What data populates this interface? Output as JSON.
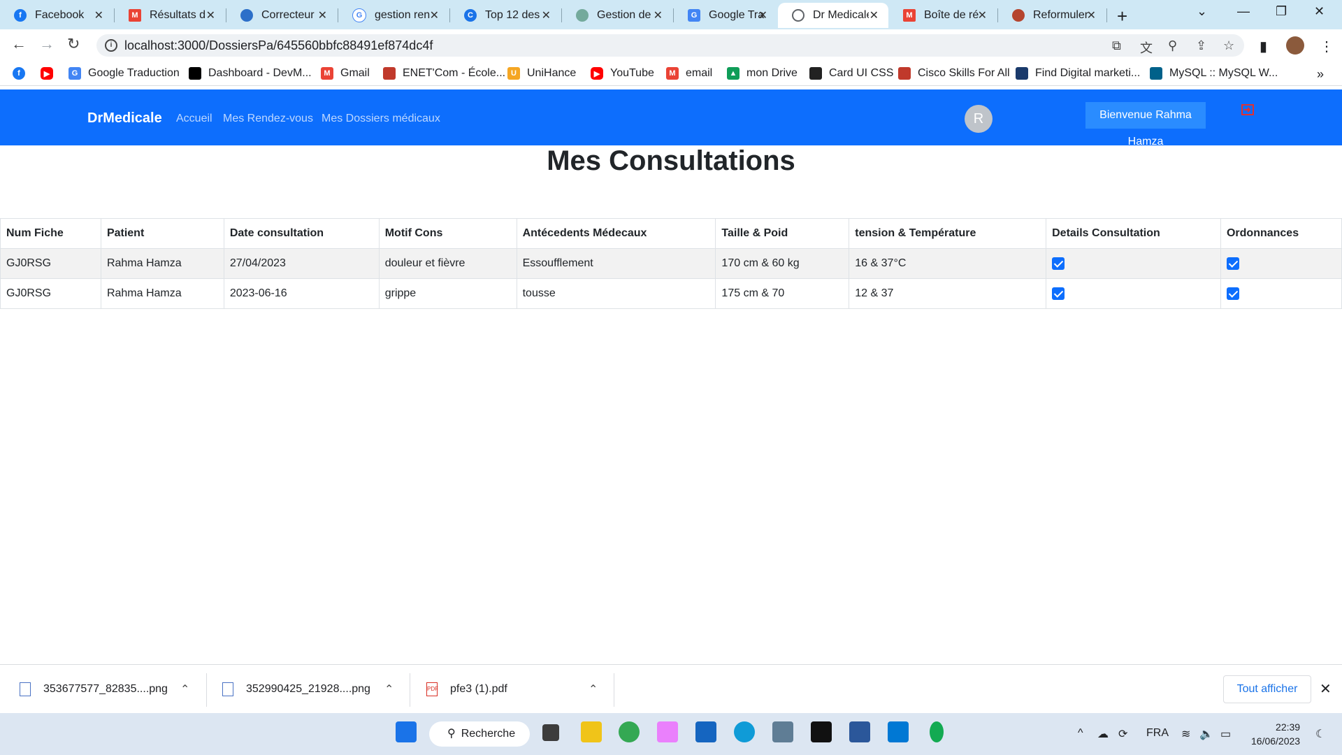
{
  "browser": {
    "tabs": [
      {
        "title": "Facebook",
        "icon": "facebook-icon",
        "color": "#1877f2"
      },
      {
        "title": "Résultats de",
        "icon": "gmail-icon",
        "color": "#ea4335"
      },
      {
        "title": "Correcteur",
        "icon": "correcteur-icon",
        "color": "#2c6fc9"
      },
      {
        "title": "gestion ren",
        "icon": "google-icon",
        "color": "#4285f4"
      },
      {
        "title": "Top 12 des",
        "icon": "top12-icon",
        "color": "#1a73e8"
      },
      {
        "title": "Gestion de",
        "icon": "chatgpt-icon",
        "color": "#74aa9c"
      },
      {
        "title": "Google Trac",
        "icon": "google-translate-icon",
        "color": "#4285f4"
      },
      {
        "title": "Dr Medicale",
        "icon": "globe-icon",
        "color": "#5f6368"
      },
      {
        "title": "Boîte de ré",
        "icon": "gmail-icon",
        "color": "#ea4335"
      },
      {
        "title": "Reformuler",
        "icon": "reformuler-icon",
        "color": "#b5452f"
      }
    ],
    "url": "localhost:3000/DossiersPa/645560bbfc88491ef874dc4f",
    "bookmarks": [
      {
        "label": "",
        "icon": "facebook-icon",
        "color": "#1877f2"
      },
      {
        "label": "",
        "icon": "youtube-icon",
        "color": "#ff0000"
      },
      {
        "label": "Google Traduction",
        "icon": "google-translate-icon",
        "color": "#4285f4"
      },
      {
        "label": "Dashboard - DevM...",
        "icon": "devm-icon",
        "color": "#000000"
      },
      {
        "label": "Gmail",
        "icon": "gmail-icon",
        "color": "#ea4335"
      },
      {
        "label": "ENET'Com - École...",
        "icon": "enetcom-icon",
        "color": "#c0392b"
      },
      {
        "label": "UniHance",
        "icon": "unihance-icon",
        "color": "#f5a623"
      },
      {
        "label": "YouTube",
        "icon": "youtube-icon",
        "color": "#ff0000"
      },
      {
        "label": "email",
        "icon": "gmail-icon",
        "color": "#ea4335"
      },
      {
        "label": "mon Drive",
        "icon": "drive-icon",
        "color": "#0f9d58"
      },
      {
        "label": "Card UI CSS",
        "icon": "codepen-icon",
        "color": "#222222"
      },
      {
        "label": "Cisco Skills For All",
        "icon": "cisco-icon",
        "color": "#c0392b"
      },
      {
        "label": "Find Digital marketi...",
        "icon": "digital-icon",
        "color": "#1a3a6b"
      },
      {
        "label": "MySQL :: MySQL W...",
        "icon": "mysql-icon",
        "color": "#00618a"
      }
    ]
  },
  "navbar": {
    "brand": "DrMedicale",
    "links": [
      "Accueil",
      "Mes Rendez-vous",
      "Mes Dossiers médicaux"
    ],
    "avatar_letter": "R",
    "welcome": "Bienvenue Rahma Hamza",
    "color": "#0d6efd"
  },
  "page": {
    "title": "Mes Consultations"
  },
  "table": {
    "headers": [
      "Num Fiche",
      "Patient",
      "Date consultation",
      "Motif Cons",
      "Antécedents Médecaux",
      "Taille & Poid",
      "tension & Température",
      "Details Consultation",
      "Ordonnances"
    ],
    "rows": [
      {
        "num": "GJ0RSG",
        "patient": "Rahma Hamza",
        "date": "27/04/2023",
        "motif": "douleur et fièvre",
        "antecedents": "Essoufflement",
        "taille_poid": "170 cm & 60 kg",
        "tension_temp": "16 & 37°C",
        "details": true,
        "ordonnances": true
      },
      {
        "num": "GJ0RSG",
        "patient": "Rahma Hamza",
        "date": "2023-06-16",
        "motif": "grippe",
        "antecedents": "tousse",
        "taille_poid": "175 cm & 70",
        "tension_temp": "12 & 37",
        "details": true,
        "ordonnances": true
      }
    ]
  },
  "downloads": {
    "items": [
      {
        "name": "353677577_82835....png",
        "type": "png"
      },
      {
        "name": "352990425_21928....png",
        "type": "png"
      },
      {
        "name": "pfe3 (1).pdf",
        "type": "pdf"
      }
    ],
    "show_all": "Tout afficher"
  },
  "taskbar": {
    "search": "Recherche",
    "lang": "FRA",
    "time": "22:39",
    "date": "16/06/2023"
  }
}
